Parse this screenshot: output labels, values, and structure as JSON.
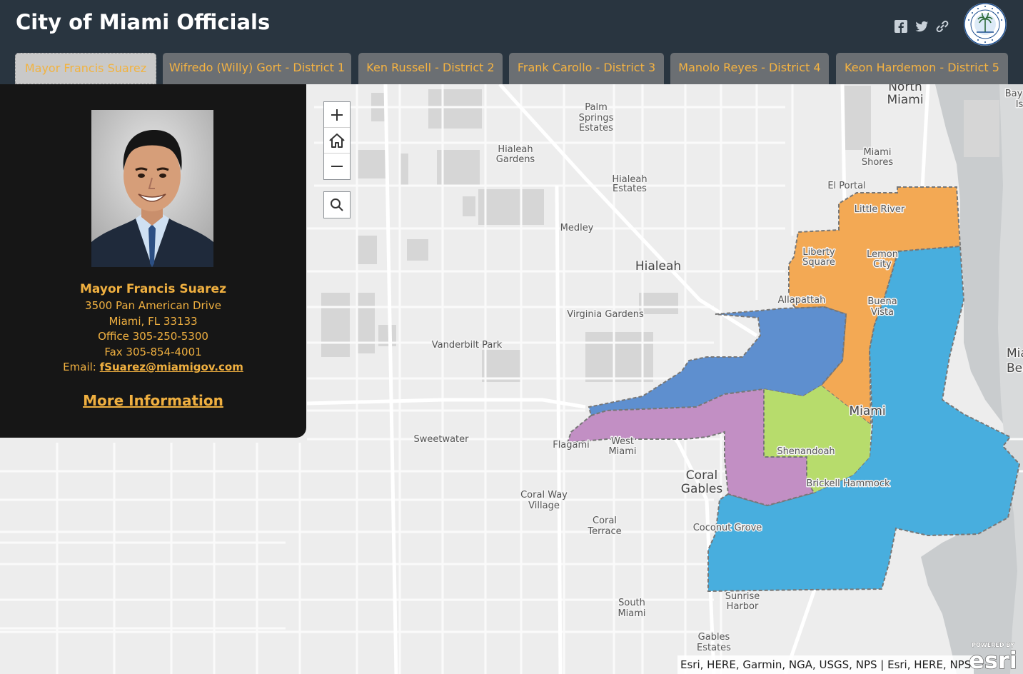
{
  "app": {
    "title": "City of Miami Officials"
  },
  "share": {
    "icons": [
      "facebook-icon",
      "twitter-icon",
      "link-icon"
    ]
  },
  "tabs": [
    {
      "label": "Mayor Francis Suarez",
      "active": true
    },
    {
      "label": "Wifredo (Willy) Gort - District 1",
      "active": false
    },
    {
      "label": "Ken Russell - District 2",
      "active": false
    },
    {
      "label": "Frank Carollo - District 3",
      "active": false
    },
    {
      "label": "Manolo Reyes - District 4",
      "active": false
    },
    {
      "label": "Keon Hardemon - District 5",
      "active": false
    }
  ],
  "official": {
    "name": "Mayor Francis Suarez",
    "address1": "3500 Pan American Drive",
    "address2": "Miami, FL 33133",
    "office": "Office 305-250-5300",
    "fax": "Fax 305-854-4001",
    "email_label": "Email: ",
    "email": "fSuarez@miamigov.com",
    "more_info": "More Information"
  },
  "map": {
    "places": {
      "north_miami_1": "North",
      "north_miami_2": "Miami",
      "bay_1": "Bay",
      "bay_2": "Is",
      "palm_1": "Palm",
      "palm_2": "Springs",
      "palm_3": "Estates",
      "hialeah_gardens_1": "Hialeah",
      "hialeah_gardens_2": "Gardens",
      "miami_shores_1": "Miami",
      "miami_shores_2": "Shores",
      "hialeah_estates_1": "Hialeah",
      "hialeah_estates_2": "Estates",
      "el_portal": "El Portal",
      "little_river": "Little River",
      "medley": "Medley",
      "liberty_1": "Liberty",
      "liberty_2": "Square",
      "lemon_1": "Lemon",
      "lemon_2": "City",
      "hialeah": "Hialeah",
      "allapattah": "Allapattah",
      "buena_1": "Buena",
      "buena_2": "Vista",
      "virginia_gardens": "Virginia Gardens",
      "vanderbilt_park": "Vanderbilt Park",
      "miami_beach_1": "Mia",
      "miami_beach_2": "Bea",
      "miami": "Miami",
      "sweetwater": "Sweetwater",
      "flagami": "Flagami",
      "west_miami_1": "West",
      "west_miami_2": "Miami",
      "shenandoah": "Shenandoah",
      "coral_gables_1": "Coral",
      "coral_gables_2": "Gables",
      "brickell": "Brickell Hammock",
      "coral_way_1": "Coral Way",
      "coral_way_2": "Village",
      "coral_terrace_1": "Coral",
      "coral_terrace_2": "Terrace",
      "coconut_grove": "Coconut Grove",
      "sunrise_1": "Sunrise",
      "sunrise_2": "Harbor",
      "south_miami_1": "South",
      "south_miami_2": "Miami",
      "gables_estates_1": "Gables",
      "gables_estates_2": "Estates"
    },
    "district_colors": {
      "district_1": "#5e8fcf",
      "district_2": "#48aede",
      "district_3": "#c28fc4",
      "district_4": "#b7dc6c",
      "district_5": "#f3a954"
    },
    "attribution": "Esri, HERE, Garmin, NGA, USGS, NPS | Esri, HERE, NPS",
    "esri_powered": "POWERED BY",
    "esri_brand": "esri"
  }
}
